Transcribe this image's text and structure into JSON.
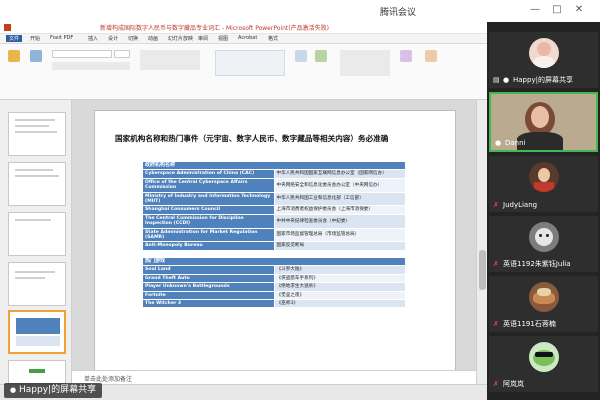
{
  "meeting": {
    "title": "腾讯会议",
    "share_label": "Happy|的屏幕共享"
  },
  "ppt": {
    "window_title": "新增构成国际数字人民币与数字藏品专业词汇 - Microsoft PowerPoint(产品激活失败)",
    "tabs": [
      "文件",
      "开始",
      "Foxit PDF",
      "插入",
      "设计",
      "切换",
      "动画",
      "幻灯片放映",
      "审阅",
      "视图",
      "Acrobat",
      "格式"
    ],
    "notes_placeholder": "单击此处添加备注"
  },
  "slide": {
    "heading": "国家机构名称和热门事件（元宇宙、数字人民币、数字藏品等相关内容）务必准确",
    "section1_header": "政府机构名称",
    "agencies": [
      {
        "en": "Cyberspace Administration of China (CAC)",
        "cn": "中华人民共和国国家互联网信息办公室（国家网信办）"
      },
      {
        "en": "Office of the Central Cyberspace Affairs Commission",
        "cn": "中央网络安全和信息化委员会办公室（中央网信办）"
      },
      {
        "en": "Ministry of Industry and Information Technology (MIIT)",
        "cn": "中华人民共和国工业和信息化部（工信部）"
      },
      {
        "en": "Shanghai Consumers Council",
        "cn": "上海市消费者权益保护委员会（上海市消保委）"
      },
      {
        "en": "The Central Commission for Discipline Inspection (CCDI)",
        "cn": "中共中央纪律检查委员会（中纪委）"
      },
      {
        "en": "State Administration for Market Regulation (SAMR)",
        "cn": "国家市场监督管理总局（市场监管总局）"
      },
      {
        "en": "Anti-Monopoly Bureau",
        "cn": "国家反垄断局"
      }
    ],
    "section2_header": "热门游戏",
    "games": [
      {
        "en": "Soul Land",
        "cn": "《斗罗大陆》"
      },
      {
        "en": "Grand Theft Auto",
        "cn": "《侠盗猎车手系列》"
      },
      {
        "en": "Player Unknown's Battlegrounds",
        "cn": "《绝地求生大逃杀》"
      },
      {
        "en": "Fortnite",
        "cn": "《堡垒之夜》"
      },
      {
        "en": "The Witcher 3",
        "cn": "《巫师3》"
      }
    ]
  },
  "participants": [
    {
      "name": "Happy|的屏幕共享",
      "avatar": "avatar-woman-photo",
      "mic": "mic-on",
      "active": false
    },
    {
      "name": "Danni",
      "avatar": "avatar-webcam",
      "mic": "mic-on",
      "active": true
    },
    {
      "name": "JudyLiang",
      "avatar": "avatar-illustration",
      "mic": "mic-off",
      "active": false
    },
    {
      "name": "英语1192朱紫钰Julia",
      "avatar": "avatar-cat-photo",
      "mic": "mic-off",
      "active": false
    },
    {
      "name": "英语1191石蓉楠",
      "avatar": "avatar-food-photo",
      "mic": "mic-off",
      "active": false
    },
    {
      "name": "阿岚岚",
      "avatar": "avatar-frog-cartoon",
      "mic": "mic-off",
      "active": false
    }
  ],
  "colors": {
    "table_header": "#4f81bd",
    "table_cell_light": "#dbe5f1",
    "active_speaker": "#3fb950",
    "panel_bg": "#232323"
  }
}
